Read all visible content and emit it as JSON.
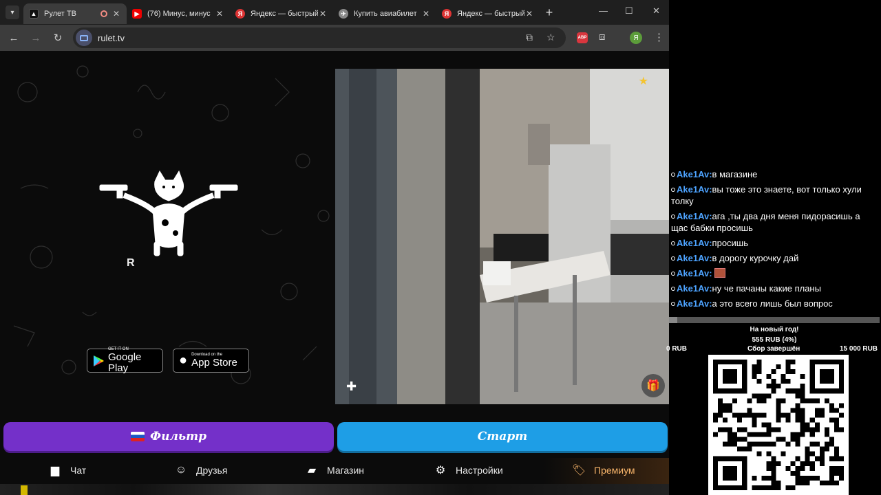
{
  "browser": {
    "tabs": [
      {
        "title": "Рулет ТВ",
        "favicon": "rulet-favicon",
        "active": true,
        "recording": true
      },
      {
        "title": "(76) Минус, минус",
        "favicon": "youtube-favicon",
        "active": false
      },
      {
        "title": "Яндекс — быстрый",
        "favicon": "yandex-favicon",
        "active": false
      },
      {
        "title": "Купить авиабилет",
        "favicon": "aviasales-favicon",
        "active": false
      },
      {
        "title": "Яндекс — быстрый",
        "favicon": "yandex-favicon",
        "active": false
      }
    ],
    "url": "rulet.tv",
    "profile_initial": "Я",
    "abp_label": "ABP"
  },
  "page": {
    "logo_text": "R",
    "google_play": {
      "small": "GET IT ON",
      "big": "Google Play"
    },
    "app_store": {
      "small": "Download on the",
      "big": "App Store"
    },
    "filter_button": "Фильтр",
    "start_button": "Старт",
    "nav": {
      "chat": "Чат",
      "friends": "Друзья",
      "shop": "Магазин",
      "settings": "Настройки",
      "premium": "Премиум"
    }
  },
  "overlay": {
    "chat": [
      {
        "user": "Ake1Av:",
        "text": "в магазине"
      },
      {
        "user": "Ake1Av:",
        "text": "вы тоже это знаете, вот только хули толку"
      },
      {
        "user": "Ake1Av:",
        "text": "ага ,ты два дня меня пидорасишь а щас бабки просишь"
      },
      {
        "user": "Ake1Av:",
        "text": "просишь"
      },
      {
        "user": "Ake1Av:",
        "text": "в дорогу курочку дай"
      },
      {
        "user": "Ake1Av:",
        "text": "",
        "emote": true
      },
      {
        "user": "Ake1Av:",
        "text": "ну че пачаны какие планы"
      },
      {
        "user": "Ake1Av:",
        "text": "а это всего лишь был вопрос"
      }
    ],
    "goal": {
      "title": "На новый год!",
      "collected": "555 RUB (4%)",
      "progress_percent": 4,
      "start": "0 RUB",
      "status": "Сбор завершён",
      "target": "15 000 RUB"
    }
  }
}
